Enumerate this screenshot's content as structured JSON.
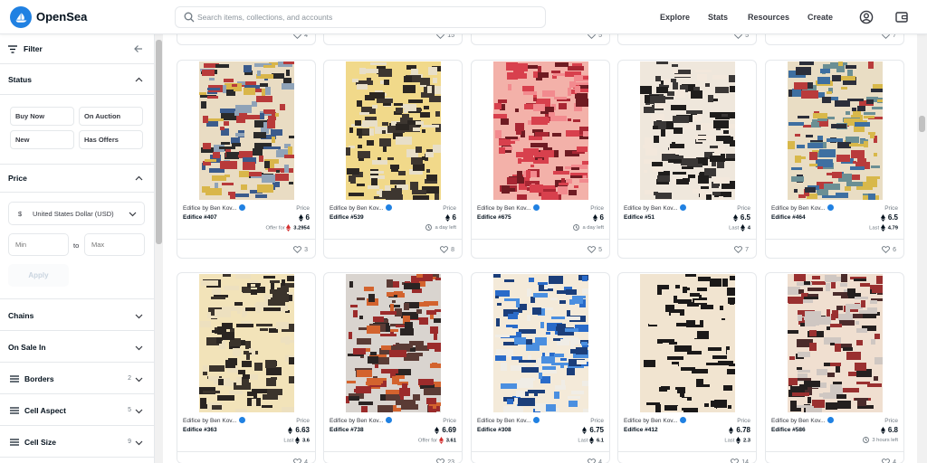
{
  "header": {
    "brand": "OpenSea",
    "search_placeholder": "Search items, collections, and accounts",
    "nav": [
      "Explore",
      "Stats",
      "Resources",
      "Create"
    ]
  },
  "sidebar": {
    "filter_label": "Filter",
    "status": {
      "title": "Status",
      "chips": [
        "Buy Now",
        "On Auction",
        "New",
        "Has Offers"
      ]
    },
    "price": {
      "title": "Price",
      "currency": "United States Dollar (USD)",
      "currency_symbol": "$",
      "min_placeholder": "Min",
      "to_label": "to",
      "max_placeholder": "Max",
      "apply_label": "Apply"
    },
    "sections": [
      {
        "title": "Chains"
      },
      {
        "title": "On Sale In"
      },
      {
        "title": "Borders",
        "count": "2"
      },
      {
        "title": "Cell Aspect",
        "count": "5"
      },
      {
        "title": "Cell Size",
        "count": "9"
      }
    ]
  },
  "top_partial_likes": [
    "4",
    "15",
    "5",
    "5",
    "7"
  ],
  "cards_row1": [
    {
      "collection": "Edifice by Ben Kov...",
      "name": "Edifice #407",
      "price_label": "Price",
      "price": "6",
      "sub_label": "Offer for",
      "sub_value": "3.2954",
      "likes": "3",
      "art": "a1"
    },
    {
      "collection": "Edifice by Ben Kov...",
      "name": "Edifice #539",
      "price_label": "Price",
      "price": "6",
      "sub_label": "a day left",
      "sub_value": "",
      "likes": "8",
      "art": "a2"
    },
    {
      "collection": "Edifice by Ben Kov...",
      "name": "Edifice #675",
      "price_label": "Price",
      "price": "6",
      "sub_label": "a day left",
      "sub_value": "",
      "likes": "5",
      "art": "a3"
    },
    {
      "collection": "Edifice by Ben Kov...",
      "name": "Edifice #51",
      "price_label": "Price",
      "price": "6.5",
      "sub_label": "Last",
      "sub_value": "4",
      "likes": "7",
      "art": "a4"
    },
    {
      "collection": "Edifice by Ben Kov...",
      "name": "Edifice #464",
      "price_label": "Price",
      "price": "6.5",
      "sub_label": "Last",
      "sub_value": "4.79",
      "likes": "6",
      "art": "a5"
    }
  ],
  "cards_row2": [
    {
      "collection": "Edifice by Ben Kov...",
      "name": "Edifice #363",
      "price_label": "Price",
      "price": "6.63",
      "sub_label": "Last",
      "sub_value": "3.6",
      "likes": "4",
      "art": "b1"
    },
    {
      "collection": "Edifice by Ben Kov...",
      "name": "Edifice #738",
      "price_label": "Price",
      "price": "6.69",
      "sub_label": "Offer for",
      "sub_value": "3.61",
      "likes": "23",
      "art": "b2"
    },
    {
      "collection": "Edifice by Ben Kov...",
      "name": "Edifice #308",
      "price_label": "Price",
      "price": "6.75",
      "sub_label": "Last",
      "sub_value": "6.1",
      "likes": "4",
      "art": "b3"
    },
    {
      "collection": "Edifice by Ben Kov...",
      "name": "Edifice #412",
      "price_label": "Price",
      "price": "6.78",
      "sub_label": "Last",
      "sub_value": "2.3",
      "likes": "14",
      "art": "b4"
    },
    {
      "collection": "Edifice by Ben Kov...",
      "name": "Edifice #586",
      "price_label": "Price",
      "price": "6.8",
      "sub_label": "3 hours left",
      "sub_value": "",
      "likes": "4",
      "art": "b5"
    }
  ],
  "colors": {
    "accent": "#2081e2",
    "border": "#e5e8eb",
    "muted": "#707a83",
    "text": "#04111d",
    "weth": "#d32f2f"
  }
}
